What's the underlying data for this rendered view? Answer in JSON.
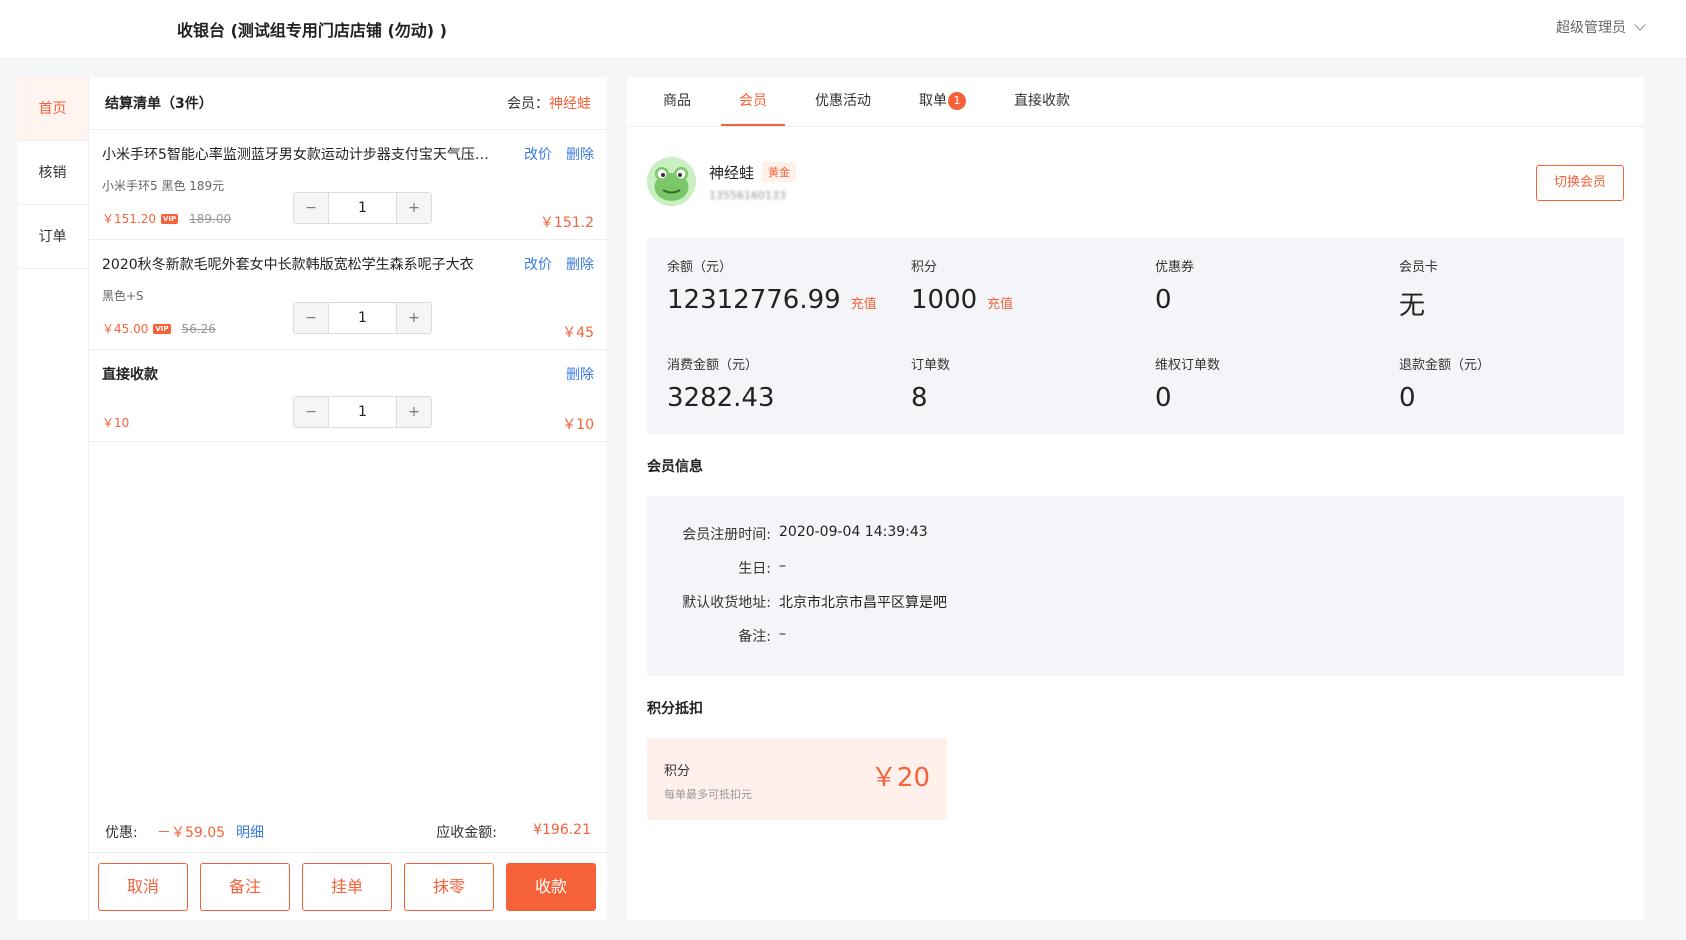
{
  "header": {
    "title": "收银台 (测试组专用门店店铺 (勿动) )",
    "user": "超级管理员"
  },
  "sidenav": [
    {
      "label": "首页",
      "active": true
    },
    {
      "label": "核销",
      "active": false
    },
    {
      "label": "订单",
      "active": false
    }
  ],
  "cart": {
    "title": "结算清单（3件）",
    "member_label": "会员：",
    "member_name": "神经蛙",
    "edit_price": "改价",
    "delete": "删除",
    "items": [
      {
        "name": "小米手环5智能心率监测蓝牙男女款运动计步器支付宝天气压力…",
        "spec": "小米手环5 黑色 189元",
        "price": "￥151.20",
        "vip": "VIP",
        "orig": "189.00",
        "qty": "1",
        "total": "￥151.2"
      },
      {
        "name": "2020秋冬新款毛呢外套女中长款韩版宽松学生森系呢子大衣",
        "spec": "黑色+S",
        "price": "￥45.00",
        "vip": "VIP",
        "orig": "56.26",
        "qty": "1",
        "total": "￥45"
      },
      {
        "name": "直接收款",
        "price": "￥10",
        "qty": "1",
        "total": "￥10"
      }
    ],
    "minus": "−",
    "plus": "+",
    "discount_label": "优惠:",
    "discount_value": "－￥59.05",
    "detail": "明细",
    "due_label": "应收金额:",
    "due_value": "¥196.21",
    "buttons": {
      "cancel": "取消",
      "note": "备注",
      "hold": "挂单",
      "round": "抹零",
      "pay": "收款"
    }
  },
  "tabs": [
    {
      "label": "商品",
      "active": false
    },
    {
      "label": "会员",
      "active": true
    },
    {
      "label": "优惠活动",
      "active": false
    },
    {
      "label": "取单",
      "active": false,
      "badge": "1"
    },
    {
      "label": "直接收款",
      "active": false
    }
  ],
  "member": {
    "name": "神经蛙",
    "level": "黄金",
    "phone": "13556160133",
    "switch": "切换会员",
    "stats": {
      "balance_label": "余额（元）",
      "balance": "12312776.99",
      "points_label": "积分",
      "points": "1000",
      "coupon_label": "优惠券",
      "coupon": "0",
      "card_label": "会员卡",
      "card": "无",
      "spend_label": "消费金额（元）",
      "spend": "3282.43",
      "orders_label": "订单数",
      "orders": "8",
      "rights_label": "维权订单数",
      "rights": "0",
      "refund_label": "退款金额（元）",
      "refund": "0",
      "charge": "充值"
    },
    "info_title": "会员信息",
    "info": {
      "reg_label": "会员注册时间:",
      "reg": "2020-09-04 14:39:43",
      "bday_label": "生日:",
      "bday": "–",
      "addr_label": "默认收货地址:",
      "addr": "北京市北京市昌平区算是吧",
      "note_label": "备注:",
      "note": "–"
    },
    "points_title": "积分抵扣",
    "points_box": {
      "label": "积分",
      "sub": "每单最多可抵扣元",
      "value": "￥20"
    }
  },
  "colors": {
    "accent": "#f5623a",
    "link": "#3a7be0"
  }
}
